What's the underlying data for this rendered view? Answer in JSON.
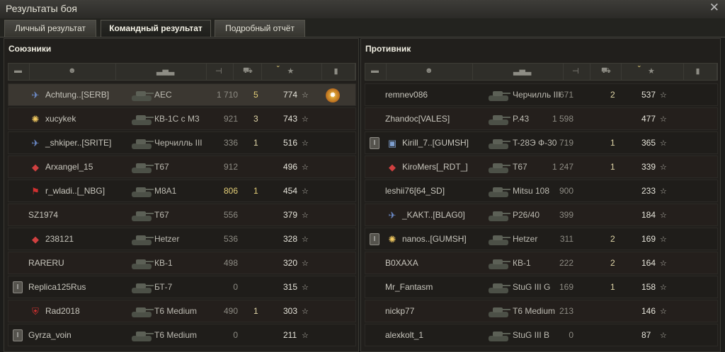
{
  "window": {
    "title": "Результаты боя",
    "close_glyph": "✕"
  },
  "tabs": [
    {
      "label": "Личный результат",
      "active": false
    },
    {
      "label": "Командный результат",
      "active": true
    },
    {
      "label": "Подробный отчёт",
      "active": false
    }
  ],
  "allies": {
    "title": "Союзники",
    "rows": [
      {
        "name": "Achtung..[SERB]",
        "tank": "AEC",
        "damage": "1 710",
        "kills": "5",
        "xp": "774",
        "badge": "plane",
        "medal": true,
        "highlight": true
      },
      {
        "name": "xucykek",
        "tank": "КВ-1С с М3",
        "damage": "921",
        "kills": "3",
        "xp": "743",
        "badge": "burst"
      },
      {
        "name": "_shkiper..[SRITE]",
        "tank": "Черчилль III",
        "damage": "336",
        "kills": "1",
        "xp": "516",
        "badge": "plane"
      },
      {
        "name": "Arxangel_15",
        "tank": "T67",
        "damage": "912",
        "kills": "",
        "xp": "496",
        "badge": "diamond"
      },
      {
        "name": "r_wladi..[_NBG]",
        "tank": "M8A1",
        "damage": "806",
        "kills": "1",
        "xp": "454",
        "badge": "flag",
        "dmg_hi": true
      },
      {
        "name": "SZ1974",
        "tank": "T67",
        "damage": "556",
        "kills": "",
        "xp": "379"
      },
      {
        "name": "238121",
        "tank": "Hetzer",
        "damage": "536",
        "kills": "",
        "xp": "328",
        "badge": "diamond"
      },
      {
        "name": "RARERU",
        "tank": "КВ-1",
        "damage": "498",
        "kills": "",
        "xp": "320"
      },
      {
        "name": "Replica125Rus",
        "tank": "БТ-7",
        "damage": "0",
        "kills": "",
        "xp": "315",
        "rank": "I"
      },
      {
        "name": "Rad2018",
        "tank": "T6 Medium",
        "damage": "490",
        "kills": "1",
        "xp": "303",
        "badge": "shield"
      },
      {
        "name": "Gyrza_voin",
        "tank": "T6 Medium",
        "damage": "0",
        "kills": "",
        "xp": "211",
        "rank": "I"
      }
    ]
  },
  "enemies": {
    "title": "Противник",
    "rows": [
      {
        "name": "remnev086",
        "tank": "Черчилль III",
        "damage": "671",
        "kills": "2",
        "xp": "537"
      },
      {
        "name": "Zhandoc[VALES]",
        "tank": "P.43",
        "damage": "1 598",
        "kills": "",
        "xp": "477"
      },
      {
        "name": "Kirill_7..[GUMSH]",
        "tank": "T-28Э Ф-30",
        "damage": "719",
        "kills": "1",
        "xp": "365",
        "rank": "I",
        "badge": "cube"
      },
      {
        "name": "KiroMers[_RDT_]",
        "tank": "T67",
        "damage": "1 247",
        "kills": "1",
        "xp": "339",
        "badge": "diamond"
      },
      {
        "name": "leshii76[64_SD]",
        "tank": "Mitsu 108",
        "damage": "900",
        "kills": "",
        "xp": "233"
      },
      {
        "name": "_KAKT..[BLAG0]",
        "tank": "P26/40",
        "damage": "399",
        "kills": "",
        "xp": "184",
        "badge": "plane"
      },
      {
        "name": "nanos..[GUMSH]",
        "tank": "Hetzer",
        "damage": "311",
        "kills": "2",
        "xp": "169",
        "rank": "I",
        "badge": "burst"
      },
      {
        "name": "B0XAXA",
        "tank": "КВ-1",
        "damage": "222",
        "kills": "2",
        "xp": "164"
      },
      {
        "name": "Mr_Fantasm",
        "tank": "StuG III G",
        "damage": "169",
        "kills": "1",
        "xp": "158"
      },
      {
        "name": "nickp77",
        "tank": "T6 Medium",
        "damage": "213",
        "kills": "",
        "xp": "146"
      },
      {
        "name": "alexkolt_1",
        "tank": "StuG III B",
        "damage": "0",
        "kills": "",
        "xp": "87"
      }
    ]
  },
  "column_icons": [
    "squad-icon",
    "player-icon",
    "tank-icon",
    "damage-icon",
    "kills-icon",
    "xp-star-icon",
    "medal-icon"
  ],
  "colors": {
    "accent_gold": "#e4cf78",
    "highlight_row": "#3b3731"
  }
}
